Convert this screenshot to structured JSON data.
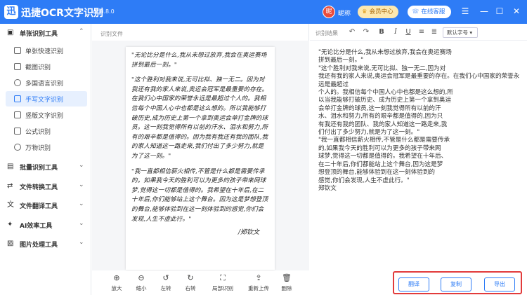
{
  "app": {
    "logo_char": "迅",
    "name": "迅捷OCR文字识别",
    "version": "v8.8.8.0",
    "avatar_char": "昵",
    "nickname": "昵称",
    "member_label": "会员中心",
    "support_label": "在线客服"
  },
  "window_controls": [
    "☰",
    "—",
    "☐",
    "✕"
  ],
  "sidebar": {
    "groups": [
      {
        "label": "单张识别工具",
        "expanded": true
      },
      {
        "label": "批量识别工具",
        "expanded": false
      },
      {
        "label": "文件转换工具",
        "expanded": false
      },
      {
        "label": "文件翻译工具",
        "expanded": false
      },
      {
        "label": "AI效率工具",
        "expanded": false
      },
      {
        "label": "图片处理工具",
        "expanded": false
      }
    ],
    "items": [
      {
        "label": "单张快速识别"
      },
      {
        "label": "截图识别"
      },
      {
        "label": "多国语言识别"
      },
      {
        "label": "手写文字识别",
        "active": true
      },
      {
        "label": "竖版文字识别"
      },
      {
        "label": "公式识别"
      },
      {
        "label": "万物识别"
      }
    ]
  },
  "left_panel": {
    "label": "识别文件",
    "handwriting": [
      "\"无论比分是什么,我从未想过放弃,我会在奥运赛场拼到最后一刻。\"",
      "\"这个胜利对我来说,无可比拟、独一无二。因为对我还有我的家人来说,奥运会冠军是最重要的存在。在我们心中国家的荣誉永远是最超过个人的。我相信每个中国人心中也都是这么想的。所以我能够打破历史,成为历史上第一个拿到奥运会单打金牌的球员。这一刻我觉得所有以前的汗水、泪水和努力,所有的艰辛都是值得的。因为我有我还有我的团队,我的家人知道这一路走来,我们付出了多少努力,就是为了这一刻。\"",
      "\"我一直都相信薪火相传,不管是什么都是需要传承的。如果我今天的胜利可以为更多的孩子带来网球梦,觉得这一切都是值得的。我希望在十年后,在二十年后,你们能够站上这个舞台。因为这是梦想登顶的舞台,能够体验到在这一刻体验到的感觉,你们会发现,人生不虚此行。\""
    ],
    "signature": "/郑钦文",
    "tools": [
      {
        "icon": "⊕",
        "label": "放大"
      },
      {
        "icon": "⊖",
        "label": "缩小"
      },
      {
        "icon": "↺",
        "label": "左转"
      },
      {
        "icon": "↻",
        "label": "右转"
      },
      {
        "icon": "⛶",
        "label": "局部识别"
      },
      {
        "icon": "⇪",
        "label": "重新上传"
      },
      {
        "icon": "🗑",
        "label": "删除"
      }
    ]
  },
  "right_panel": {
    "label": "识别结果",
    "font_select": "默认字号",
    "result_text": "\"无论比分是什么,我从未想过放弃,我会在奥运赛场\n拼到最后一刻。\"\n\"这个胜利对我来说,无可比拟、独一无二,因为对\n我还有我的家人来说,奥运会冠军是最重要的存在。在我们心中国家的荣誉永远是最超过\n个人的。我相信每个中国人心中也都是这么想的,所\n以当我能够打破历史、成为历史上第一个拿到奥运\n会单打金牌的球员,这一刻我觉得所有以前的汗\n水、泪水和努力,所有的艰辛都是值得的,因为只\n有我还有我的团队、我的家人知道这一路走来,我\n们付出了多少努力,就是为了这一刻。\"\n\"我一直都相信薪火相传,不管是什么都是需要传承\n的,如果我今天的胜利可以为更多的孩子带来网\n球梦,觉得这一切都是值得的。我希望在十年后、\n在二十年后,你们都能站上这个舞台,因为这是梦\n想登顶的舞台,能够体验到在这一刻体验到的\n感觉,你们会发现,人生不虚此行。\"\n郑钦文",
    "buttons": {
      "translate": "翻译",
      "copy": "复制",
      "export": "导出"
    }
  }
}
